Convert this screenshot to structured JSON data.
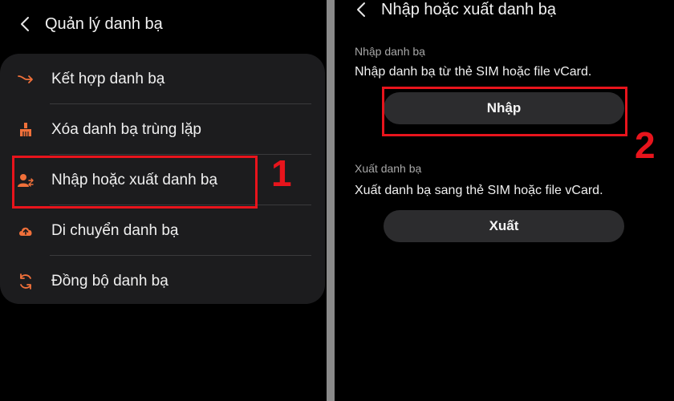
{
  "left": {
    "header": {
      "title": "Quản lý danh bạ"
    },
    "menu": [
      {
        "label": "Kết hợp danh bạ",
        "icon": "merge-icon"
      },
      {
        "label": "Xóa danh bạ trùng lặp",
        "icon": "broom-icon"
      },
      {
        "label": "Nhập hoặc xuất danh bạ",
        "icon": "contact-import-export-icon"
      },
      {
        "label": "Di chuyển danh bạ",
        "icon": "cloud-upload-icon"
      },
      {
        "label": "Đồng bộ danh bạ",
        "icon": "sync-icon"
      }
    ],
    "step": "1"
  },
  "right": {
    "header": {
      "title": "Nhập hoặc xuất danh bạ"
    },
    "import_section": {
      "title": "Nhập danh bạ",
      "description": "Nhập danh bạ từ thẻ SIM hoặc file vCard.",
      "button": "Nhập"
    },
    "export_section": {
      "title": "Xuất danh bạ",
      "description": "Xuất danh bạ sang thẻ SIM hoặc file vCard.",
      "button": "Xuất"
    },
    "step": "2"
  },
  "colors": {
    "accent_icon": "#f0703a",
    "highlight": "#e8141c",
    "card_bg": "#1c1c1e",
    "button_bg": "#2c2c2e"
  }
}
